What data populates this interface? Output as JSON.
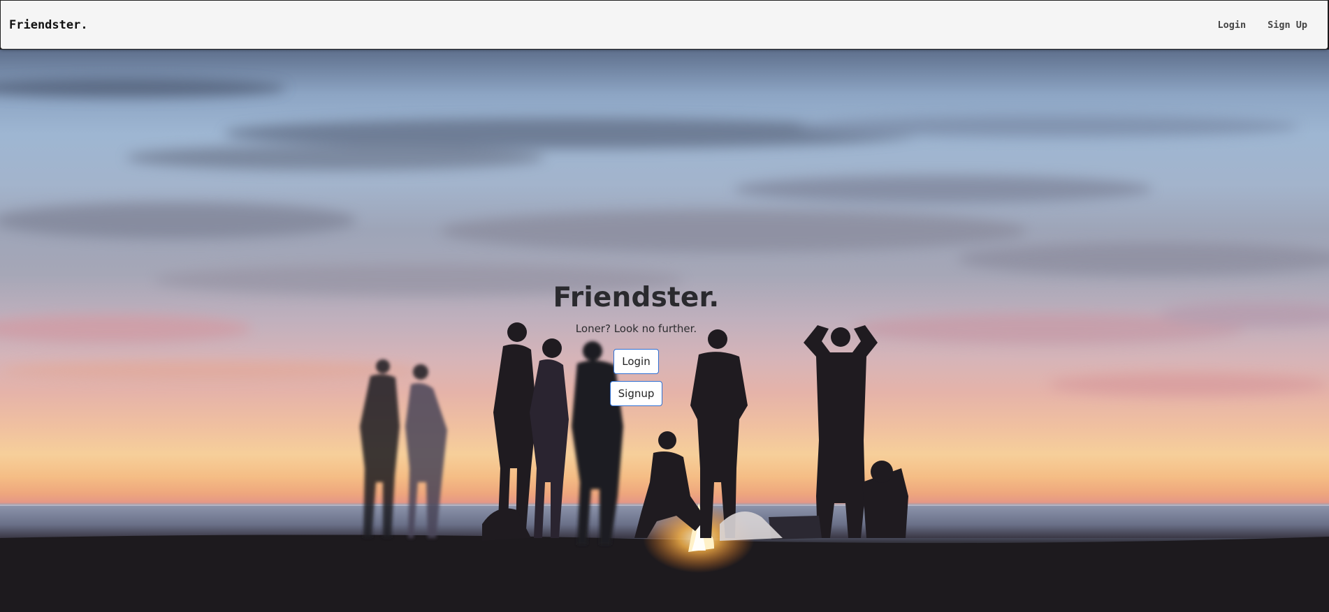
{
  "navbar": {
    "brand": "Friendster.",
    "links": [
      {
        "label": "Login"
      },
      {
        "label": "Sign Up"
      }
    ]
  },
  "hero": {
    "title": "Friendster.",
    "subtitle": "Loner? Look no further.",
    "login_button": "Login",
    "signup_button": "Signup",
    "background_image": "sunset beach bonfire with silhouetted group of friends"
  },
  "colors": {
    "navbar_bg": "#f5f5f5",
    "button_border": "#2e6fd3",
    "title_text": "#2a2a2e"
  }
}
